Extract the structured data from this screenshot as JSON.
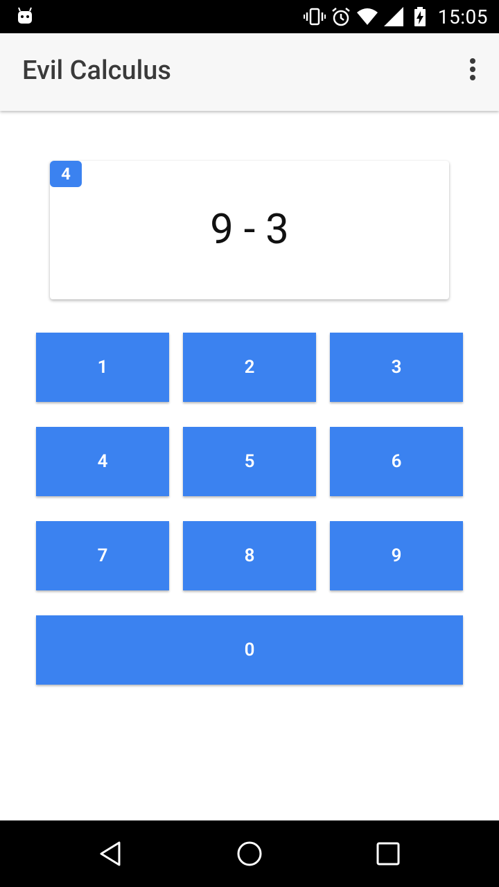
{
  "status_bar": {
    "time": "15:05",
    "icons": [
      "android-icon",
      "vibrate-icon",
      "alarm-icon",
      "wifi-icon",
      "signal-icon",
      "battery-charging-icon"
    ]
  },
  "app_bar": {
    "title": "Evil Calculus",
    "overflow_icon": "more-vert-icon"
  },
  "question": {
    "counter": "4",
    "problem": "9 - 3"
  },
  "keypad": {
    "keys": [
      "1",
      "2",
      "3",
      "4",
      "5",
      "6",
      "7",
      "8",
      "9",
      "0"
    ]
  },
  "nav_bar": {
    "icons": [
      "back-icon",
      "home-icon",
      "recents-icon"
    ]
  },
  "colors": {
    "accent": "#3b82f0",
    "app_bar_bg": "#f7f7f7",
    "title_text": "#3a3a3a"
  }
}
